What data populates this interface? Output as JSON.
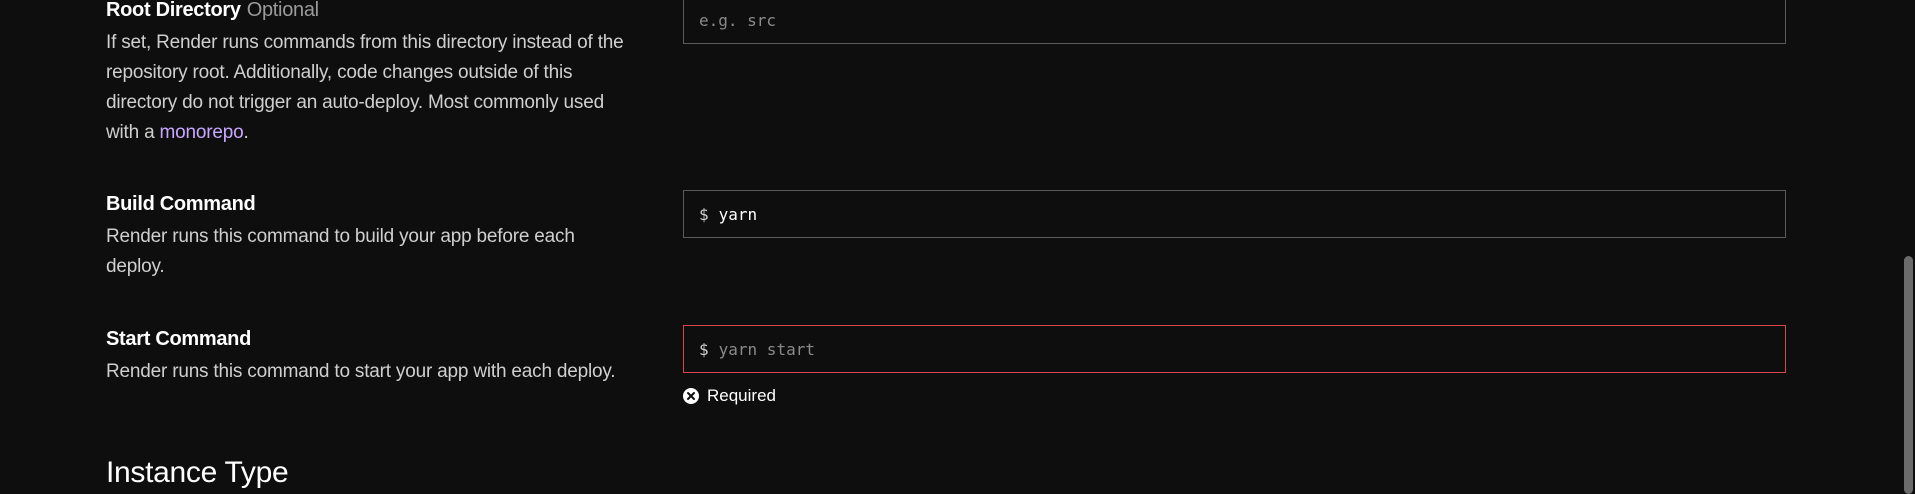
{
  "root_directory": {
    "label": "Root Directory",
    "optional": "Optional",
    "description_before_link": "If set, Render runs commands from this directory instead of the repository root. Additionally, code changes outside of this directory do not trigger an auto-deploy. Most commonly used with a ",
    "link_text": "monorepo",
    "description_after_link": ".",
    "placeholder": "e.g. src",
    "value": ""
  },
  "build_command": {
    "label": "Build Command",
    "description": "Render runs this command to build your app before each deploy.",
    "prefix": "$",
    "value": "yarn",
    "placeholder": ""
  },
  "start_command": {
    "label": "Start Command",
    "description": "Render runs this command to start your app with each deploy.",
    "prefix": "$",
    "value": "",
    "placeholder": "yarn start",
    "error": "Required"
  },
  "instance_type": {
    "heading": "Instance Type"
  },
  "colors": {
    "background": "#0e0e0e",
    "link": "#c9a6ff",
    "error_border": "#d9454e",
    "input_border": "#5a5a5a"
  },
  "icons": {
    "error": "x-circle-icon"
  }
}
